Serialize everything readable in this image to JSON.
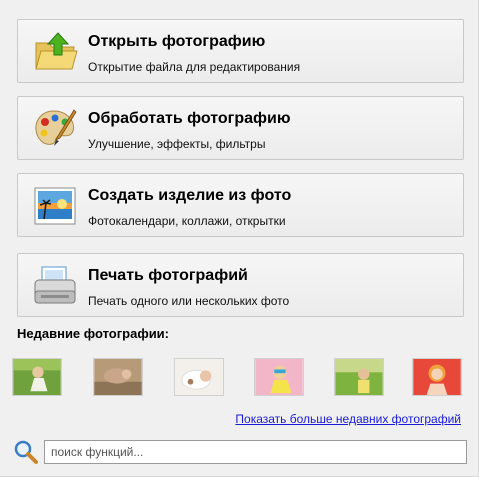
{
  "actions": [
    {
      "title": "Открыть фотографию",
      "subtitle": "Открытие файла для редактирования",
      "icon": "open-folder-icon"
    },
    {
      "title": "Обработать фотографию",
      "subtitle": "Улучшение, эффекты, фильтры",
      "icon": "palette-icon"
    },
    {
      "title": "Создать изделие из фото",
      "subtitle": "Фотокалендари, коллажи, открытки",
      "icon": "photo-icon"
    },
    {
      "title": "Печать фотографий",
      "subtitle": "Печать одного или нескольких фото",
      "icon": "printer-icon"
    }
  ],
  "recent": {
    "title": "Недавние фотографии:",
    "more_link": "Показать больше недавних фотографий"
  },
  "search": {
    "placeholder": "поиск функций..."
  },
  "colors": {
    "link": "#1a1ad8",
    "background": "#f0f0f0"
  }
}
